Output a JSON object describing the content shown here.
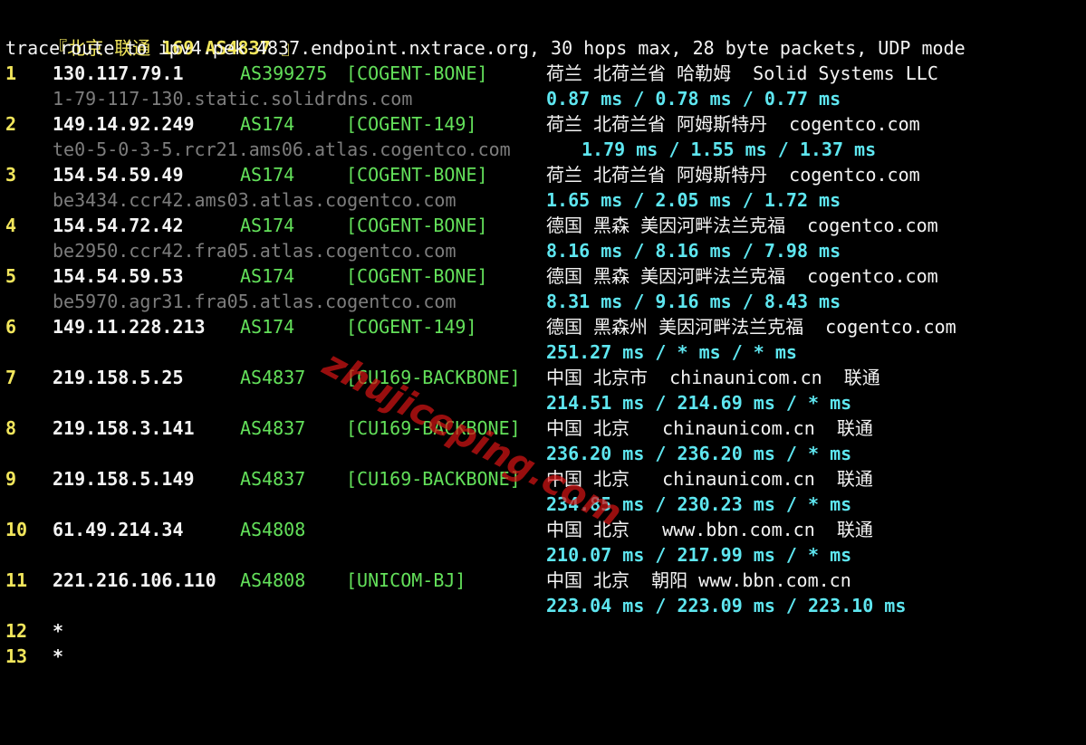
{
  "header": {
    "bracket_open": "『",
    "location": "北京 联通 ",
    "tag": "169 AS4837",
    "bracket_close": " 』"
  },
  "command": "traceroute to ipv4.pek-4837.endpoint.nxtrace.org, 30 hops max, 28 byte packets, UDP mode",
  "hops": [
    {
      "num": "1",
      "ip": "130.117.79.1",
      "asn": "AS399275",
      "tag": "[COGENT-BONE]",
      "geo": "荷兰 北荷兰省 哈勒姆  Solid Systems LLC",
      "rdns": "1-79-117-130.static.solidrdns.com",
      "rtt": "0.87 ms / 0.78 ms / 0.77 ms"
    },
    {
      "num": "2",
      "ip": "149.14.92.249",
      "asn": "AS174",
      "tag": "[COGENT-149]",
      "geo": "荷兰 北荷兰省 阿姆斯特丹  cogentco.com",
      "rdns": "te0-5-0-3-5.rcr21.ams06.atlas.cogentco.com",
      "rtt": "1.79 ms / 1.55 ms / 1.37 ms"
    },
    {
      "num": "3",
      "ip": "154.54.59.49",
      "asn": "AS174",
      "tag": "[COGENT-BONE]",
      "geo": "荷兰 北荷兰省 阿姆斯特丹  cogentco.com",
      "rdns": "be3434.ccr42.ams03.atlas.cogentco.com",
      "rtt": "1.65 ms / 2.05 ms / 1.72 ms"
    },
    {
      "num": "4",
      "ip": "154.54.72.42",
      "asn": "AS174",
      "tag": "[COGENT-BONE]",
      "geo": "德国 黑森 美因河畔法兰克福  cogentco.com",
      "rdns": "be2950.ccr42.fra05.atlas.cogentco.com",
      "rtt": "8.16 ms / 8.16 ms / 7.98 ms"
    },
    {
      "num": "5",
      "ip": "154.54.59.53",
      "asn": "AS174",
      "tag": "[COGENT-BONE]",
      "geo": "德国 黑森 美因河畔法兰克福  cogentco.com",
      "rdns": "be5970.agr31.fra05.atlas.cogentco.com",
      "rtt": "8.31 ms / 9.16 ms / 8.43 ms"
    },
    {
      "num": "6",
      "ip": "149.11.228.213",
      "asn": "AS174",
      "tag": "[COGENT-149]",
      "geo": "德国 黑森州 美因河畔法兰克福  cogentco.com",
      "rdns": "",
      "rtt": "251.27 ms / * ms / * ms"
    },
    {
      "num": "7",
      "ip": "219.158.5.25",
      "asn": "AS4837",
      "tag": "[CU169-BACKBONE]",
      "geo": "中国 北京市  chinaunicom.cn  联通",
      "rdns": "",
      "rtt": "214.51 ms / 214.69 ms / * ms"
    },
    {
      "num": "8",
      "ip": "219.158.3.141",
      "asn": "AS4837",
      "tag": "[CU169-BACKBONE]",
      "geo": "中国 北京   chinaunicom.cn  联通",
      "rdns": "",
      "rtt": "236.20 ms / 236.20 ms / * ms"
    },
    {
      "num": "9",
      "ip": "219.158.5.149",
      "asn": "AS4837",
      "tag": "[CU169-BACKBONE]",
      "geo": "中国 北京   chinaunicom.cn  联通",
      "rdns": "",
      "rtt": "234.85 ms / 230.23 ms / * ms"
    },
    {
      "num": "10",
      "ip": "61.49.214.34",
      "asn": "AS4808",
      "tag": "",
      "geo": "中国 北京   www.bbn.com.cn  联通",
      "rdns": "",
      "rtt": "210.07 ms / 217.99 ms / * ms"
    },
    {
      "num": "11",
      "ip": "221.216.106.110",
      "asn": "AS4808",
      "tag": "[UNICOM-BJ]",
      "geo": "中国 北京  朝阳 www.bbn.com.cn",
      "rdns": "",
      "rtt": "223.04 ms / 223.09 ms / 223.10 ms"
    }
  ],
  "timeouts": [
    {
      "num": "12",
      "mark": "*"
    },
    {
      "num": "13",
      "mark": "*"
    }
  ],
  "watermark": "zhujiceping.com",
  "colors": {
    "background": "#000000",
    "hop_number": "#f2e65c",
    "ip": "#f4f4f4",
    "asn_tag": "#63e05a",
    "rdns": "#7d7d7d",
    "rtt": "#5ee6f0",
    "watermark": "#d21414"
  }
}
